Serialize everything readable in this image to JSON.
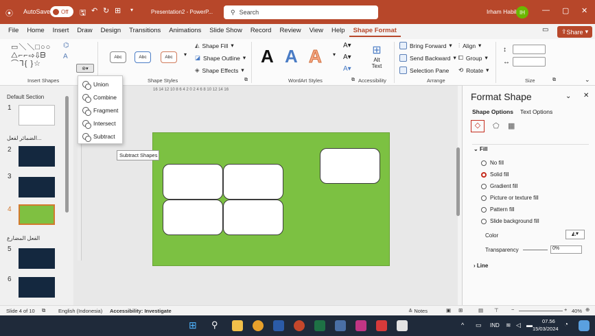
{
  "titlebar": {
    "autosave_label": "AutoSave",
    "autosave_state": "Off",
    "doc_title": "Presentation2 - PowerP...",
    "search_placeholder": "Search",
    "user_name": "Irham Habib",
    "user_initials": "IH"
  },
  "menu": {
    "tabs": [
      "File",
      "Home",
      "Insert",
      "Draw",
      "Design",
      "Transitions",
      "Animations",
      "Slide Show",
      "Record",
      "Review",
      "View",
      "Help",
      "Shape Format"
    ],
    "active_tab": "Shape Format",
    "share_label": "Share"
  },
  "ribbon": {
    "insert_shapes_label": "Insert Shapes",
    "style_btn_label": "Abc",
    "shape_fill": "Shape Fill",
    "shape_outline": "Shape Outline",
    "shape_effects": "Shape Effects",
    "shape_styles_label": "Shape Styles",
    "wordart_label": "WordArt Styles",
    "wordart_glyph": "A",
    "alt_text": "Alt Text",
    "accessibility_label": "Accessibility",
    "bring_forward": "Bring Forward",
    "send_backward": "Send Backward",
    "selection_pane": "Selection Pane",
    "align": "Align",
    "group": "Group",
    "rotate": "Rotate",
    "arrange_label": "Arrange",
    "size_label": "Size"
  },
  "merge_menu": {
    "items": [
      "Union",
      "Combine",
      "Fragment",
      "Intersect",
      "Subtract"
    ],
    "tooltip": "Subtract Shapes"
  },
  "thumbnails": {
    "default_section": "Default Section",
    "section2": "الضمائر لفعل...",
    "section3": "الفعل المضارع",
    "slide_numbers": [
      "1",
      "2",
      "3",
      "4",
      "5",
      "6"
    ]
  },
  "ruler_text": "16 14 12 10 8 6 4 2 0 2 4 6 8 10 12 14 16",
  "format_pane": {
    "title": "Format Shape",
    "tab_shape_options": "Shape Options",
    "tab_text_options": "Text Options",
    "fill_header": "Fill",
    "fill_options": [
      "No fill",
      "Solid fill",
      "Gradient fill",
      "Picture or texture fill",
      "Pattern fill",
      "Slide background fill"
    ],
    "selected_fill": "Solid fill",
    "color_label": "Color",
    "transparency_label": "Transparency",
    "transparency_value": "0%",
    "line_header": "Line"
  },
  "status": {
    "slide_info": "Slide 4 of 10",
    "language": "English (Indonesia)",
    "accessibility": "Accessibility: Investigate",
    "notes": "Notes",
    "zoom": "40%"
  },
  "taskbar": {
    "lang": "IND",
    "time": "07.56",
    "date": "15/03/2024"
  },
  "colors": {
    "accent": "#b7472a",
    "slide_bg": "#7cc142",
    "selected_thumb_border": "#d3792e"
  }
}
